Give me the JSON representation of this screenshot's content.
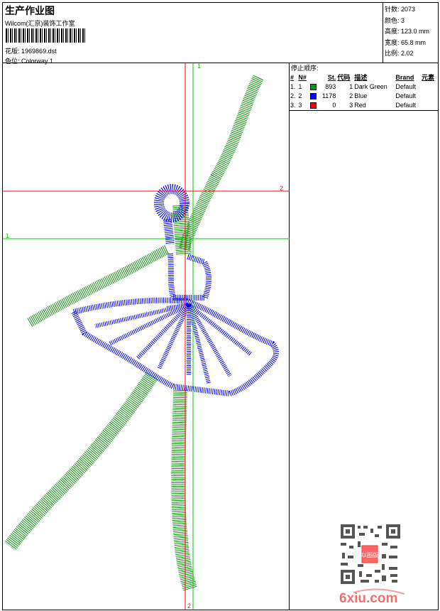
{
  "header": {
    "title": "生产作业图",
    "company": "Wilcom(汇京)装饰工作室",
    "file_label": "花版:",
    "file_value": "1969869.dst",
    "colorway_label": "色位:",
    "colorway_value": "Colorway 1"
  },
  "info": [
    {
      "label": "针数:",
      "value": "2073"
    },
    {
      "label": "颜色:",
      "value": "3"
    },
    {
      "label": "高度:",
      "value": "123.0 mm"
    },
    {
      "label": "宽度:",
      "value": "65.8 mm"
    },
    {
      "label": "比例:",
      "value": "2.02"
    }
  ],
  "stop_sequence": {
    "caption": "停止顺序:",
    "columns": [
      "#",
      "N#",
      "",
      "St.",
      "代码",
      "描述",
      "Brand",
      "元素"
    ],
    "rows": [
      {
        "idx": "1.",
        "n": "1",
        "color": "#109010",
        "st": "893",
        "code": "1",
        "desc": "Dark Green",
        "brand": "Default"
      },
      {
        "idx": "2.",
        "n": "2",
        "color": "#0000ff",
        "st": "1178",
        "code": "2",
        "desc": "Blue",
        "brand": "Default"
      },
      {
        "idx": "3.",
        "n": "3",
        "color": "#ff0000",
        "st": "0",
        "code": "3",
        "desc": "Red",
        "brand": "Default"
      }
    ]
  },
  "guides": {
    "v1": "1",
    "v2": "2",
    "h1": "1",
    "h2": "2"
  },
  "watermark": {
    "text": "6xiu.com",
    "seal": "以图版"
  }
}
